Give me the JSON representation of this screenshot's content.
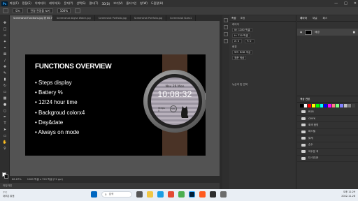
{
  "app": {
    "logo": "Ps",
    "menu": [
      "파일(F)",
      "편집(E)",
      "이미지(I)",
      "레이어(L)",
      "문자(Y)",
      "선택(S)",
      "필터(T)",
      "3D(D)",
      "보기(V)",
      "플러그인",
      "창(W)",
      "도움말(H)"
    ]
  },
  "options": {
    "field1": "모드",
    "field2": "전경 전경을 보기",
    "percent": "100%"
  },
  "tabs": [
    "Screenshot Functions.jpg @ 66.7% (RGB/8)",
    "Screenshot Aligha Watch.jpg",
    "Screenshot Portfolio.jpg",
    "Screenshot Portfolio.jpg",
    "Screenshot Sizes1"
  ],
  "document": {
    "heading": "FUNCTIONS OVERVIEW",
    "features": [
      "• Steps display",
      "• Battery %",
      "• 12/24 hour time",
      "• Backgroud colorx4",
      "• Day&date",
      "• Always on mode"
    ],
    "watch": {
      "date": "Nov 26 Mon",
      "time": "10:08:32",
      "steps_label": "Steps",
      "steps_value": "0",
      "battery": "56%"
    }
  },
  "status": {
    "zoom": "66.67%",
    "size": "1280 픽셀 x 720 픽셀 (72 ppi)"
  },
  "timeline": {
    "label": "타임라인"
  },
  "properties": {
    "tabs": [
      "속성",
      "조정"
    ],
    "rows": [
      "레이어",
      "W: 1280 픽셀",
      "H: 720 픽셀",
      "X: 0",
      "Y: 0",
      "배경",
      "모드 RGB 색상",
      "표준 색상"
    ],
    "apply": "뉴금과 및 반복"
  },
  "layers": {
    "tabs": [
      "레이어",
      "채널",
      "패스"
    ],
    "layer_name": "배경"
  },
  "swatches": {
    "title": "색상 견본",
    "colors": [
      "#000000",
      "#ffffff",
      "#ff0000",
      "#ffff00",
      "#00ff00",
      "#00ffff",
      "#0000ff",
      "#ff00ff",
      "#ff8080",
      "#80ff80",
      "#8080ff",
      "#c0c0c0",
      "#808080",
      "#404040"
    ],
    "folders": [
      "RGB",
      "CMYK",
      "회색 음영",
      "파스텔",
      "밝게",
      "순수",
      "어두운 색",
      "더 어두운"
    ]
  },
  "taskbar": {
    "weather": "7°C",
    "weather_sub": "대부분 맑음",
    "search": "검색",
    "time": "오후 11:29",
    "date": "2022-11-28"
  }
}
